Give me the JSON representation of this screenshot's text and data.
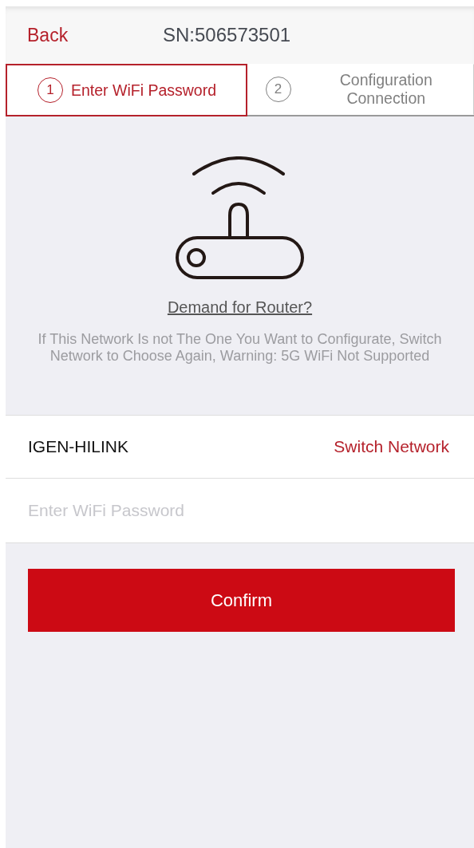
{
  "header": {
    "back": "Back",
    "title": "SN:506573501"
  },
  "steps": [
    {
      "number": "1",
      "label": "Enter WiFi Password",
      "selected": true
    },
    {
      "number": "2",
      "label": "Configuration Connection",
      "selected": false
    }
  ],
  "router": {
    "link": "Demand for Router?",
    "hint": "If This Network Is not The One You Want to Configurate, Switch Network to Choose Again, Warning: 5G WiFi Not Supported"
  },
  "network": {
    "name": "IGEN-HILINK",
    "action": "Switch Network"
  },
  "password": {
    "placeholder": "Enter WiFi Password"
  },
  "confirm": "Confirm"
}
